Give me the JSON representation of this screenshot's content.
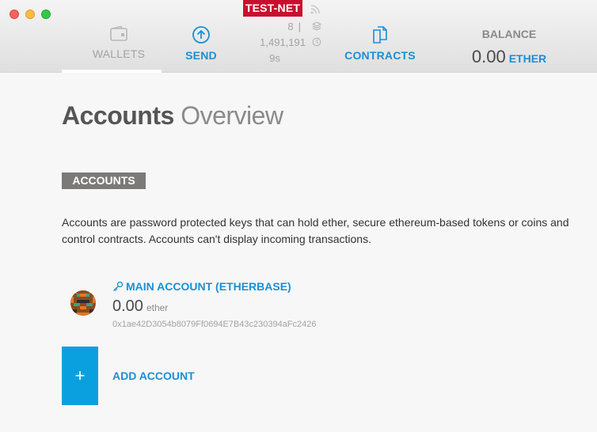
{
  "header": {
    "network_badge": "TEST-NET",
    "nav": {
      "wallets": "WALLETS",
      "send": "SEND",
      "contracts": "CONTRACTS"
    },
    "block_info": {
      "peers": "8",
      "separator": "|",
      "block_number": "1,491,191",
      "time_since_block": "9s"
    },
    "balance": {
      "label": "BALANCE",
      "amount": "0.00",
      "unit": "ETHER"
    }
  },
  "page": {
    "title_primary": "Accounts",
    "title_secondary": "Overview"
  },
  "accounts_section": {
    "label": "ACCOUNTS",
    "description": "Accounts are password protected keys that can hold ether, secure ethereum-based tokens or coins and control contracts. Accounts can't display incoming transactions."
  },
  "accounts": [
    {
      "name": "MAIN ACCOUNT (ETHERBASE)",
      "amount": "0.00",
      "unit": "ether",
      "address": "0x1ae42D3054b8079Ff0694E7B43c230394aFc2426"
    }
  ],
  "add_account": {
    "button_symbol": "+",
    "label": "ADD ACCOUNT"
  },
  "colors": {
    "accent_blue": "#1a8fd6",
    "add_button_blue": "#0aa0e0",
    "testnet_red": "#c8102e",
    "section_label_gray": "#7d7979"
  },
  "icons": {
    "wallets": "wallet-icon",
    "send": "send-arrow-icon",
    "contracts": "contracts-icon",
    "network": "rss-icon",
    "block": "layers-icon",
    "time": "clock-icon",
    "account_key": "key-icon",
    "identicon": "identicon-avatar"
  }
}
